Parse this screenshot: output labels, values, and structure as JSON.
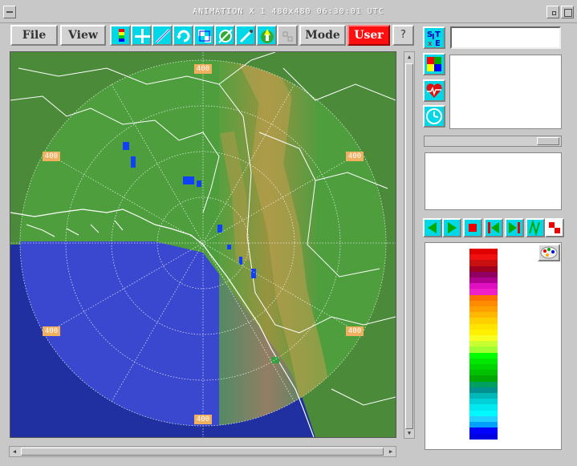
{
  "window": {
    "title": "ANIMATION  X 1  480x480   06:30:01 UTC"
  },
  "toolbar": {
    "file_label": "File",
    "view_label": "View",
    "mode_label": "Mode",
    "user_label": "User",
    "help_label": "?",
    "icons": [
      "color-table-icon",
      "crosshair-icon",
      "draw-line-icon",
      "refresh-icon",
      "zoom-box-icon",
      "overlay-icon",
      "pen-icon",
      "north-arrow-icon",
      "disabled-tool-icon"
    ]
  },
  "map": {
    "range_ring_labels": [
      "400",
      "400",
      "400",
      "400",
      "400",
      "400"
    ]
  },
  "side": {
    "site_label": "SITE",
    "site_value": "",
    "icons": [
      "site-icon",
      "layers-icon",
      "health-vb-icon",
      "clock-icon"
    ]
  },
  "playback": {
    "icons": [
      "step-back-icon",
      "play-icon",
      "stop-icon",
      "first-frame-icon",
      "last-frame-icon",
      "loop-icon",
      "checker-icon"
    ]
  },
  "legend": {
    "colors": [
      "#e00000",
      "#f01010",
      "#c81010",
      "#a00020",
      "#900060",
      "#b00090",
      "#e010c0",
      "#f020c8",
      "#ff7000",
      "#ff8c00",
      "#ffa000",
      "#ffb800",
      "#ffd000",
      "#ffe400",
      "#fff000",
      "#f8ff20",
      "#c8ff30",
      "#a0ff30",
      "#00ff00",
      "#00e800",
      "#00d400",
      "#00c000",
      "#00a800",
      "#00a060",
      "#009090",
      "#00b8b8",
      "#00d0d8",
      "#00e8f0",
      "#00f8ff",
      "#20d0ff",
      "#00a0ff",
      "#0000ff",
      "#0000e0"
    ]
  }
}
